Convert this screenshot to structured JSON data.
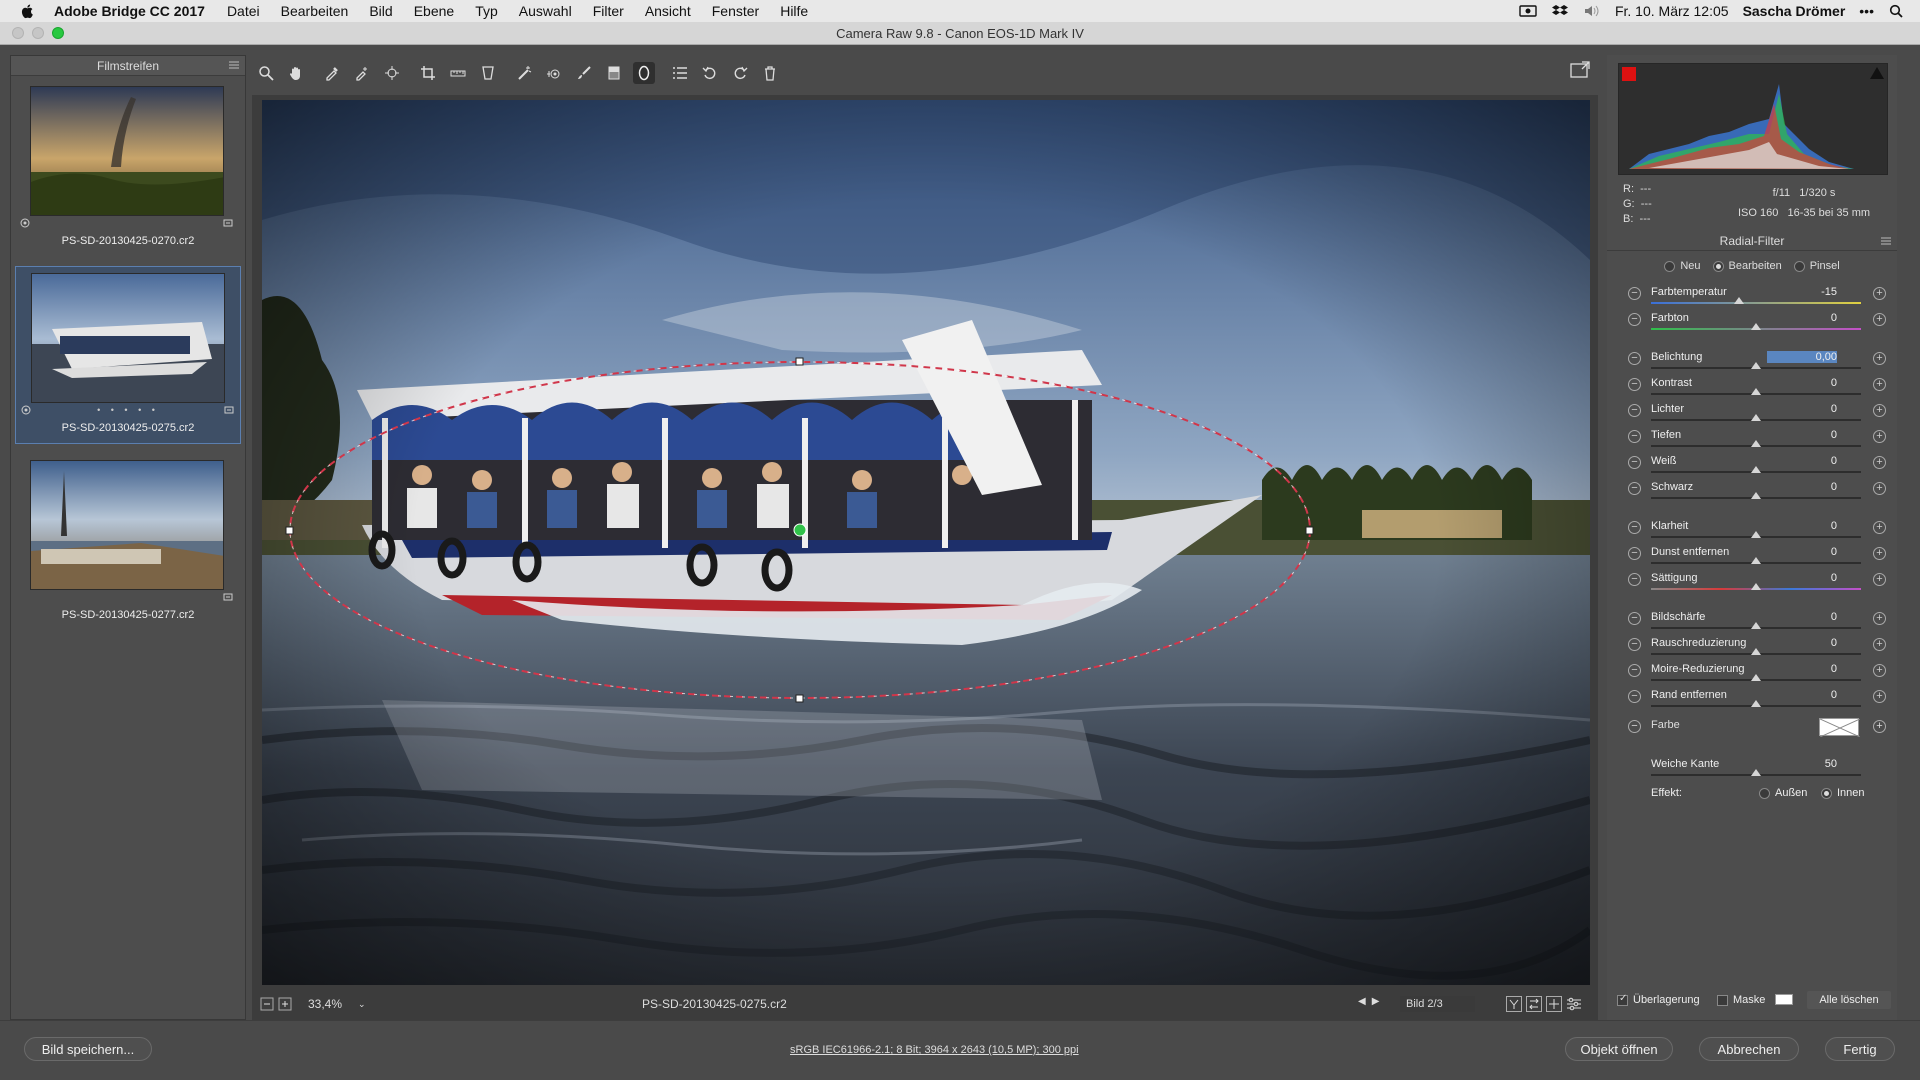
{
  "menubar": {
    "app_name": "Adobe Bridge CC 2017",
    "items": [
      "Datei",
      "Bearbeiten",
      "Bild",
      "Ebene",
      "Typ",
      "Auswahl",
      "Filter",
      "Ansicht",
      "Fenster",
      "Hilfe"
    ],
    "datetime": "Fr. 10. März  12:05",
    "user": "Sascha Drömer",
    "more": "•••"
  },
  "window": {
    "title": "Camera Raw 9.8  -  Canon EOS-1D Mark IV"
  },
  "filmstrip": {
    "title": "Filmstreifen",
    "items": [
      {
        "name": "PS-SD-20130425-0270.cr2"
      },
      {
        "name": "PS-SD-20130425-0275.cr2",
        "rating_dots": "• • • • •"
      },
      {
        "name": "PS-SD-20130425-0277.cr2"
      }
    ]
  },
  "canvas": {
    "zoom": "33,4%",
    "filename": "PS-SD-20130425-0275.cr2",
    "image_count": "Bild 2/3"
  },
  "exif": {
    "r_label": "R:",
    "r_val": "---",
    "g_label": "G:",
    "g_val": "---",
    "b_label": "B:",
    "b_val": "---",
    "aperture": "f/11",
    "shutter": "1/320 s",
    "iso": "ISO 160",
    "lens": "16-35 bei 35 mm"
  },
  "panel": {
    "title": "Radial-Filter",
    "modes": [
      {
        "label": "Neu"
      },
      {
        "label": "Bearbeiten"
      },
      {
        "label": "Pinsel"
      }
    ],
    "sliders": [
      {
        "label": "Farbtemperatur",
        "value": "-15",
        "pos": 0.42
      },
      {
        "label": "Farbton",
        "value": "0",
        "pos": 0.5
      },
      {
        "label": "Belichtung",
        "value": "0,00",
        "pos": 0.5
      },
      {
        "label": "Kontrast",
        "value": "0",
        "pos": 0.5
      },
      {
        "label": "Lichter",
        "value": "0",
        "pos": 0.5
      },
      {
        "label": "Tiefen",
        "value": "0",
        "pos": 0.5
      },
      {
        "label": "Weiß",
        "value": "0",
        "pos": 0.5
      },
      {
        "label": "Schwarz",
        "value": "0",
        "pos": 0.5
      },
      {
        "label": "Klarheit",
        "value": "0",
        "pos": 0.5
      },
      {
        "label": "Dunst entfernen",
        "value": "0",
        "pos": 0.5
      },
      {
        "label": "Sättigung",
        "value": "0",
        "pos": 0.5
      },
      {
        "label": "Bildschärfe",
        "value": "0",
        "pos": 0.5
      },
      {
        "label": "Rauschreduzierung",
        "value": "0",
        "pos": 0.5
      },
      {
        "label": "Moire-Reduzierung",
        "value": "0",
        "pos": 0.5
      },
      {
        "label": "Rand entfernen",
        "value": "0",
        "pos": 0.5
      }
    ],
    "color_label": "Farbe",
    "feather": {
      "label": "Weiche Kante",
      "value": "50",
      "pos": 0.5
    },
    "effect": {
      "label": "Effekt:",
      "outside": "Außen",
      "inside": "Innen"
    },
    "overlay_label": "Überlagerung",
    "mask_label": "Maske",
    "clear_all": "Alle löschen"
  },
  "bottom": {
    "save": "Bild speichern...",
    "workflow": "sRGB IEC61966-2.1; 8 Bit; 3964 x 2643 (10,5 MP); 300 ppi",
    "open": "Objekt öffnen",
    "cancel": "Abbrechen",
    "done": "Fertig"
  },
  "colors": {
    "accent": "#5b7fb0",
    "filter_ellipse": "#d0364a",
    "clip_warning": "#dd1111"
  }
}
